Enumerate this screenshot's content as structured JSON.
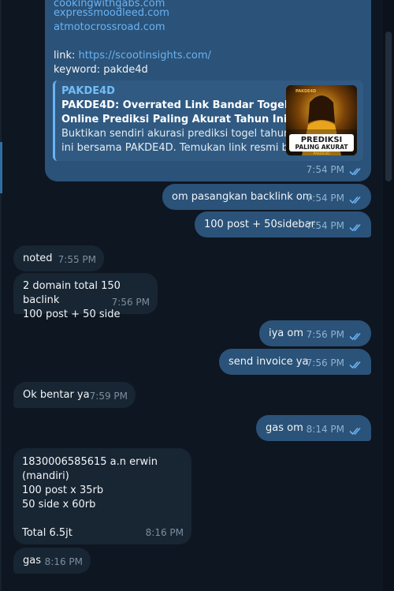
{
  "message1": {
    "top_lines": [
      "cookingwithgabs.com",
      "expressmoodleed.com",
      "atmotocrossroad.com"
    ],
    "link_prefix": "link:",
    "link_url": "https://scootinsights.com/",
    "keyword_line": "keyword: pakde4d",
    "preview": {
      "site": "PAKDE4D",
      "title_line1": "PAKDE4D: Overrated Link Bandar Togel",
      "title_line2": "Online Prediksi Paling Akurat Tahun Ini",
      "desc_line1": "Buktikan sendiri akurasi prediksi togel tahun",
      "desc_line2": "ini bersama PAKDE4D. Temukan link resmi ba...",
      "thumb_top": "PREDIKSI",
      "thumb_bottom": "PALING AKURAT",
      "thumb_brand": "PAKDE4D",
      "thumb_logo": "PAKDE4D"
    },
    "time": "7:54 PM"
  },
  "messages": [
    {
      "id": "m2",
      "text": "om pasangkan backlink om",
      "time": "7:54 PM"
    },
    {
      "id": "m3",
      "text": "100 post + 50sidebar",
      "time": "7:54 PM"
    },
    {
      "id": "m4",
      "text": "noted",
      "time": "7:55 PM"
    },
    {
      "id": "m5",
      "line1": "2 domain total 150 baclink",
      "line2": "100 post + 50 side",
      "time": "7:56 PM"
    },
    {
      "id": "m6",
      "text": "iya om",
      "time": "7:56 PM"
    },
    {
      "id": "m7",
      "text": "send invoice ya",
      "time": "7:56 PM"
    },
    {
      "id": "m8",
      "text": "Ok bentar ya",
      "time": "7:59 PM"
    },
    {
      "id": "m9",
      "text": "gas om",
      "time": "8:14 PM"
    },
    {
      "id": "m10",
      "line1": "1830006585615 a.n erwin (mandiri)",
      "line2": "100 post x 35rb",
      "line3": "50 side x 60rb",
      "line4": "Total 6.5jt",
      "time": "8:16 PM"
    },
    {
      "id": "m11",
      "text": "gas",
      "time": "8:16 PM"
    }
  ],
  "colors": {
    "background": "#0e1621",
    "outgoing_bubble": "#2b5278",
    "incoming_bubble": "#182533",
    "link": "#6ab3f3"
  },
  "icons": {
    "read_receipt": "double-check-icon"
  }
}
